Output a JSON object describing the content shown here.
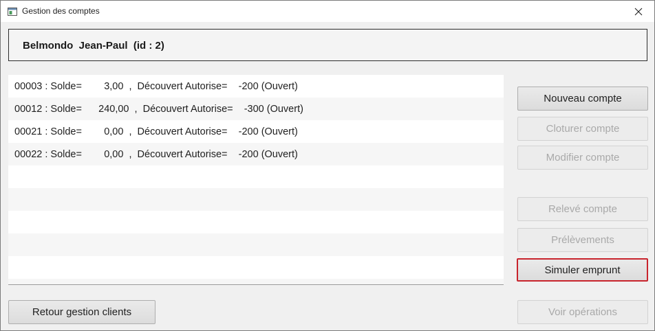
{
  "window": {
    "title": "Gestion des comptes"
  },
  "client": {
    "label": "Belmondo  Jean-Paul  (id : 2)"
  },
  "accounts": [
    "00003 : Solde=        3,00  ,  Découvert Autorise=    -200 (Ouvert)",
    "00012 : Solde=      240,00  ,  Découvert Autorise=    -300 (Ouvert)",
    "00021 : Solde=        0,00  ,  Découvert Autorise=    -200 (Ouvert)",
    "00022 : Solde=        0,00  ,  Découvert Autorise=    -200 (Ouvert)"
  ],
  "buttons": {
    "nouveau": "Nouveau compte",
    "cloturer": "Cloturer compte",
    "modifier": "Modifier compte",
    "releve": "Relevé compte",
    "prelevements": "Prélèvements",
    "simuler": "Simuler emprunt",
    "retour": "Retour gestion clients",
    "voir": "Voir opérations"
  },
  "icons": {
    "app": "window-app-icon",
    "close": "close-icon"
  },
  "colors": {
    "focus_border": "#c8232c",
    "disabled_text": "#a9a9a9",
    "window_bg": "#f0f0f0"
  }
}
